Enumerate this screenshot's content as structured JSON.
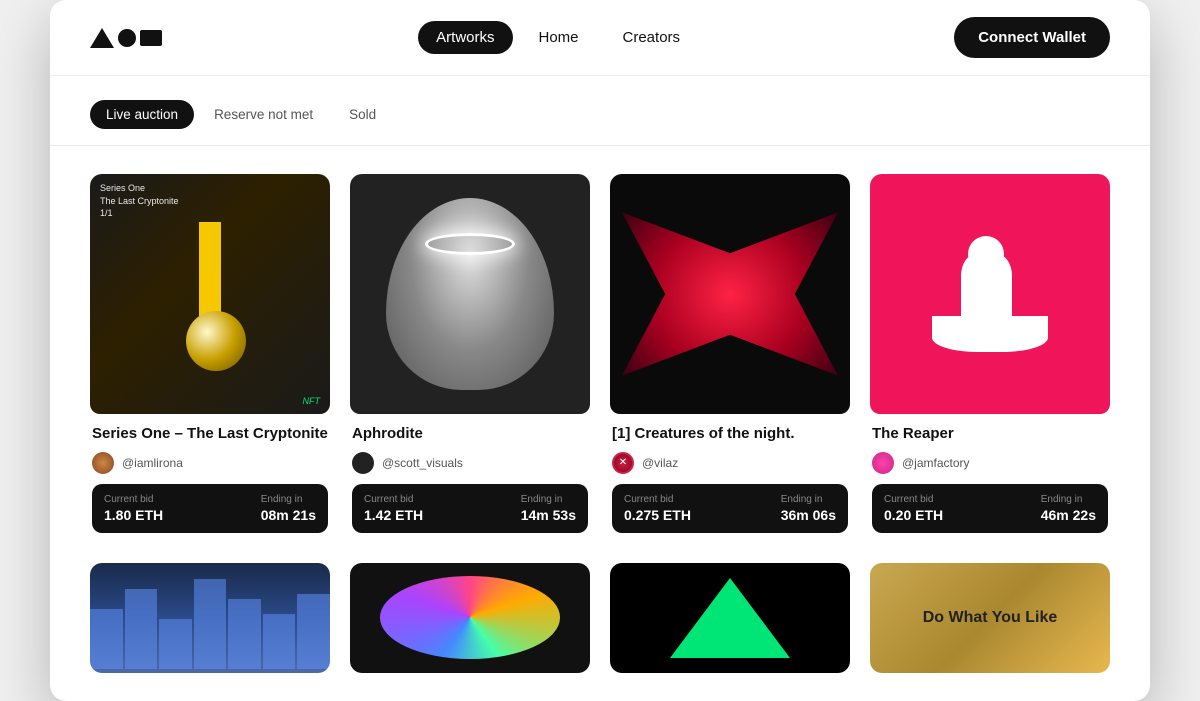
{
  "logo": {
    "label": "AOE"
  },
  "nav": {
    "links": [
      {
        "id": "artworks",
        "label": "Artworks",
        "active": true
      },
      {
        "id": "home",
        "label": "Home",
        "active": false
      },
      {
        "id": "creators",
        "label": "Creators",
        "active": false
      }
    ],
    "connect_wallet": "Connect Wallet"
  },
  "filters": [
    {
      "id": "live-auction",
      "label": "Live auction",
      "active": true
    },
    {
      "id": "reserve-not-met",
      "label": "Reserve not met",
      "active": false
    },
    {
      "id": "sold",
      "label": "Sold",
      "active": false
    }
  ],
  "artworks": [
    {
      "id": "series-one",
      "title": "Series One – The Last Cryptonite",
      "author": "@iamlirona",
      "current_bid_label": "Current bid",
      "current_bid": "1.80 ETH",
      "ending_label": "Ending in",
      "ending": "08m 21s",
      "image_label": "Series One\nThe Last Cryptonite\n1/1"
    },
    {
      "id": "aphrodite",
      "title": "Aphrodite",
      "author": "@scott_visuals",
      "current_bid_label": "Current bid",
      "current_bid": "1.42 ETH",
      "ending_label": "Ending in",
      "ending": "14m 53s",
      "image_label": ""
    },
    {
      "id": "creatures",
      "title": "[1] Creatures of the night.",
      "author": "@vilaz",
      "current_bid_label": "Current bid",
      "current_bid": "0.275 ETH",
      "ending_label": "Ending in",
      "ending": "36m 06s",
      "image_label": ""
    },
    {
      "id": "reaper",
      "title": "The Reaper",
      "author": "@jamfactory",
      "current_bid_label": "Current bid",
      "current_bid": "0.20 ETH",
      "ending_label": "Ending in",
      "ending": "46m 22s",
      "image_label": ""
    }
  ],
  "bottom_row": [
    {
      "id": "city",
      "type": "city"
    },
    {
      "id": "disco",
      "type": "disco"
    },
    {
      "id": "pyramid",
      "type": "pyramid"
    },
    {
      "id": "graffiti",
      "type": "graffiti",
      "text": "Do What\nYou Like"
    }
  ]
}
